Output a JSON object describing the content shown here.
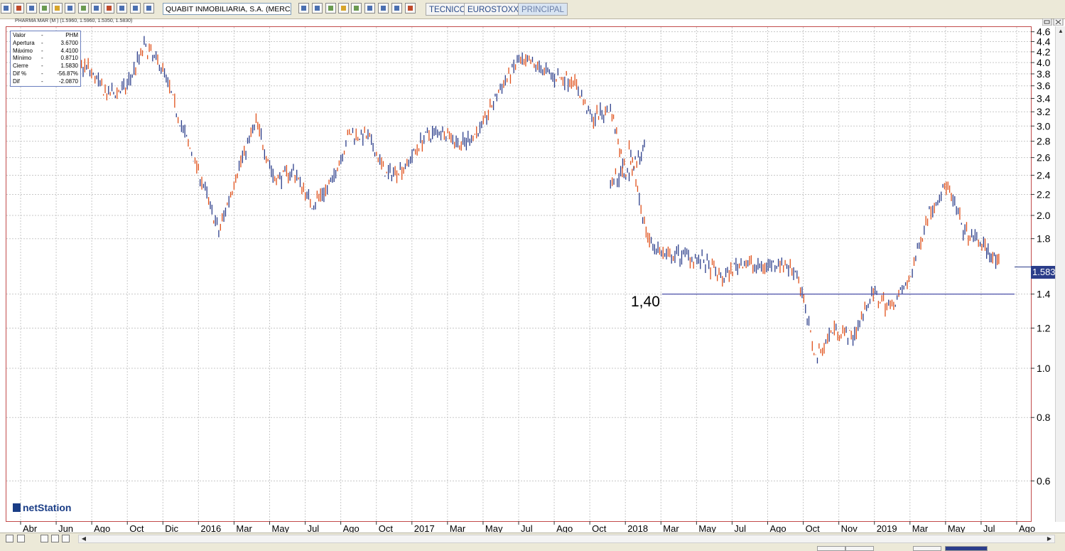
{
  "toolbar": {
    "symbol_value": "QUABIT INMOBILIARIA, S.A. (MERCADO CON",
    "tabs": [
      {
        "label": "TECNICO",
        "active": false
      },
      {
        "label": "EUROSTOXX",
        "active": false
      },
      {
        "label": "PRINCIPAL",
        "active": true
      }
    ]
  },
  "chart_header": "PHARMA MAR (M ) (1.5960, 1.5960, 1.5350, 1.5830)",
  "info_box": {
    "rows": [
      {
        "key": "Valor",
        "dash": "-",
        "value": "PHM"
      },
      {
        "key": "Apertura",
        "dash": "-",
        "value": "3.6700"
      },
      {
        "key": "Máximo",
        "dash": "-",
        "value": "4.4100"
      },
      {
        "key": "Mínimo",
        "dash": "-",
        "value": "0.8710"
      },
      {
        "key": "Cierre",
        "dash": "-",
        "value": "1.5830"
      },
      {
        "key": "Dif %",
        "dash": "-",
        "value": "-56.87%"
      },
      {
        "key": "Dif",
        "dash": "-",
        "value": "-2.0870"
      }
    ]
  },
  "brand": "netStation",
  "support_label": "1,40",
  "last_price_label": "1.583",
  "colors": {
    "up": "#2b3d8a",
    "down": "#e0501a",
    "support": "#4a4fa8",
    "frame": "#c24b4b",
    "grid": "#c8c8c8",
    "badge": "#2b3d8a"
  },
  "chart_data": {
    "type": "ohlc",
    "y_scale": "log",
    "ylim": [
      0.5,
      4.7
    ],
    "y_ticks": [
      4.6,
      4.4,
      4.2,
      4.0,
      3.8,
      3.6,
      3.4,
      3.2,
      3.0,
      2.8,
      2.6,
      2.4,
      2.2,
      2.0,
      1.8,
      1.4,
      1.2,
      1.0,
      0.8,
      0.6
    ],
    "x_ticks": [
      "Abr",
      "Jun",
      "Ago",
      "Oct",
      "Dic",
      "2016",
      "Mar",
      "May",
      "Jul",
      "Ago",
      "Oct",
      "2017",
      "Mar",
      "May",
      "Jul",
      "Ago",
      "Oct",
      "2018",
      "Mar",
      "May",
      "Jul",
      "Ago",
      "Oct",
      "Nov",
      "2019",
      "Mar",
      "May",
      "Jul",
      "Ago"
    ],
    "x_range": [
      "2015-04",
      "2019-08"
    ],
    "series": [
      {
        "values": [
          {
            "date": "2015-03",
            "close": 3.85
          },
          {
            "date": "2015-04",
            "close": 3.7
          },
          {
            "date": "2015-05",
            "close": 3.75
          },
          {
            "date": "2015-06",
            "close": 4.05
          },
          {
            "date": "2015-07",
            "close": 3.9
          },
          {
            "date": "2015-08",
            "close": 3.45
          },
          {
            "date": "2015-09",
            "close": 3.55
          },
          {
            "date": "2015-10",
            "close": 4.3
          },
          {
            "date": "2015-11",
            "close": 3.9
          },
          {
            "date": "2015-12",
            "close": 3.0
          },
          {
            "date": "2016-01",
            "close": 2.4
          },
          {
            "date": "2016-02",
            "close": 1.85
          },
          {
            "date": "2016-03",
            "close": 2.45
          },
          {
            "date": "2016-04",
            "close": 3.05
          },
          {
            "date": "2016-05",
            "close": 2.35
          },
          {
            "date": "2016-06",
            "close": 2.45
          },
          {
            "date": "2016-07",
            "close": 2.1
          },
          {
            "date": "2016-08",
            "close": 2.3
          },
          {
            "date": "2016-09",
            "close": 2.9
          },
          {
            "date": "2016-10",
            "close": 2.85
          },
          {
            "date": "2016-11",
            "close": 2.4
          },
          {
            "date": "2016-12",
            "close": 2.5
          },
          {
            "date": "2017-01",
            "close": 2.85
          },
          {
            "date": "2017-02",
            "close": 2.95
          },
          {
            "date": "2017-03",
            "close": 2.75
          },
          {
            "date": "2017-04",
            "close": 2.95
          },
          {
            "date": "2017-05",
            "close": 3.5
          },
          {
            "date": "2017-06",
            "close": 4.0
          },
          {
            "date": "2017-07",
            "close": 3.95
          },
          {
            "date": "2017-08",
            "close": 3.75
          },
          {
            "date": "2017-09",
            "close": 3.7
          },
          {
            "date": "2017-10",
            "close": 3.1
          },
          {
            "date": "2017-11",
            "close": 3.25
          },
          {
            "date": "2017-11",
            "close": 2.35
          },
          {
            "date": "2017-12",
            "close": 2.45
          },
          {
            "date": "2017-12",
            "close": 2.7
          },
          {
            "date": "2018-01",
            "close": 1.8
          },
          {
            "date": "2018-02",
            "close": 1.65
          },
          {
            "date": "2018-03",
            "close": 1.68
          },
          {
            "date": "2018-04",
            "close": 1.62
          },
          {
            "date": "2018-05",
            "close": 1.5
          },
          {
            "date": "2018-06",
            "close": 1.62
          },
          {
            "date": "2018-07",
            "close": 1.58
          },
          {
            "date": "2018-08",
            "close": 1.62
          },
          {
            "date": "2018-09",
            "close": 1.55
          },
          {
            "date": "2018-10",
            "close": 1.05
          },
          {
            "date": "2018-11",
            "close": 1.2
          },
          {
            "date": "2018-12",
            "close": 1.15
          },
          {
            "date": "2019-01",
            "close": 1.4
          },
          {
            "date": "2019-02",
            "close": 1.32
          },
          {
            "date": "2019-03",
            "close": 1.48
          },
          {
            "date": "2019-04",
            "close": 2.0
          },
          {
            "date": "2019-05",
            "close": 2.3
          },
          {
            "date": "2019-06",
            "close": 1.85
          },
          {
            "date": "2019-07",
            "close": 1.75
          },
          {
            "date": "2019-07",
            "close": 1.583
          }
        ]
      }
    ],
    "support_level": 1.4,
    "last_close": 1.583,
    "grid": true
  }
}
